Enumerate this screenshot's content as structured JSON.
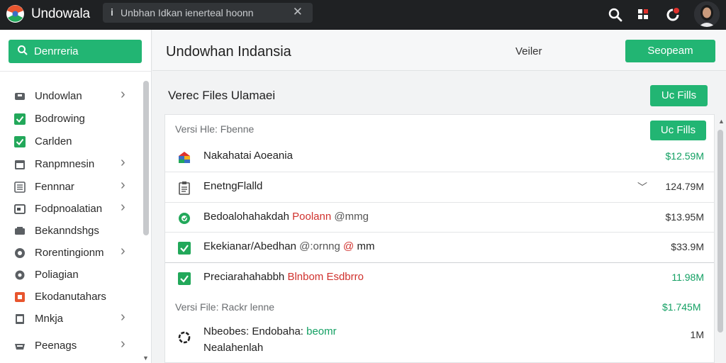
{
  "app": {
    "title": "Undowala"
  },
  "top_search": {
    "text": "Unbhan Idkan ienerteal hoonn"
  },
  "sidebar": {
    "search_label": "Denrreria",
    "items": [
      {
        "label": "Undowlan",
        "icon": "bag-icon",
        "chevron": true
      },
      {
        "label": "Bodrowing",
        "icon": "check-box-icon",
        "chevron": false
      },
      {
        "label": "Carlden",
        "icon": "check-box-icon",
        "chevron": false
      },
      {
        "label": "Ranpmnesin",
        "icon": "calendar-icon",
        "chevron": true
      },
      {
        "label": "Fennnar",
        "icon": "list-icon",
        "chevron": true
      },
      {
        "label": "Fodpnoalatian",
        "icon": "folder-icon",
        "chevron": true
      },
      {
        "label": "Bekanndshgs",
        "icon": "card-icon",
        "chevron": false
      },
      {
        "label": "Rorentingionm",
        "icon": "globe-icon",
        "chevron": true
      },
      {
        "label": "Poliagian",
        "icon": "gear-icon",
        "chevron": false
      },
      {
        "label": "Ekodanutahars",
        "icon": "orange-box-icon",
        "chevron": false
      },
      {
        "label": "Mnkja",
        "icon": "document-icon",
        "chevron": true
      },
      {
        "label": "Peenags",
        "icon": "tray-icon",
        "chevron": true
      }
    ]
  },
  "header": {
    "title": "Undowhan Indansia",
    "view_label": "Veiler",
    "action_label": "Seopeam"
  },
  "main": {
    "section_title": "Verec Files Ulamaei",
    "upload_label": "Uc Fills",
    "group1_label": "Versi Hle: Fbenne",
    "group1_upload_label": "Uc Fills",
    "group2_label": "Versi File: Rackr lenne",
    "group2_size": "$1.745M",
    "rows": [
      {
        "name": "Nakahatai Aoeania",
        "size": "$12.59M",
        "icon": "app-grid-icon"
      },
      {
        "name": "EnetngFlalld",
        "size": "124.79M",
        "icon": "clipboard-icon"
      },
      {
        "name_main": "Bedoalohahakdah",
        "name_red": "Poolann",
        "name_tail": "@mmg",
        "size": "$13.95M",
        "icon": "green-badge-icon"
      },
      {
        "name_main": "Ekekianar/Abedhan",
        "name_gray": "@:ornng",
        "name_red": "@",
        "name_tail": "mm",
        "size": "$33.9M",
        "icon": "green-check-icon"
      },
      {
        "name_main": "Preciarahahabbh",
        "name_red": "Blnbom Esdbrro",
        "size": "11.98M",
        "icon": "green-check-icon"
      },
      {
        "name_main": "Nbeobes: Endobaha:",
        "name_green": "beomr",
        "name_line2": "Nealahenlah",
        "size": "1M",
        "icon": "ring-icon"
      }
    ]
  },
  "colors": {
    "accent": "#22b573",
    "topbar": "#1f2123",
    "danger": "#d0312d"
  }
}
